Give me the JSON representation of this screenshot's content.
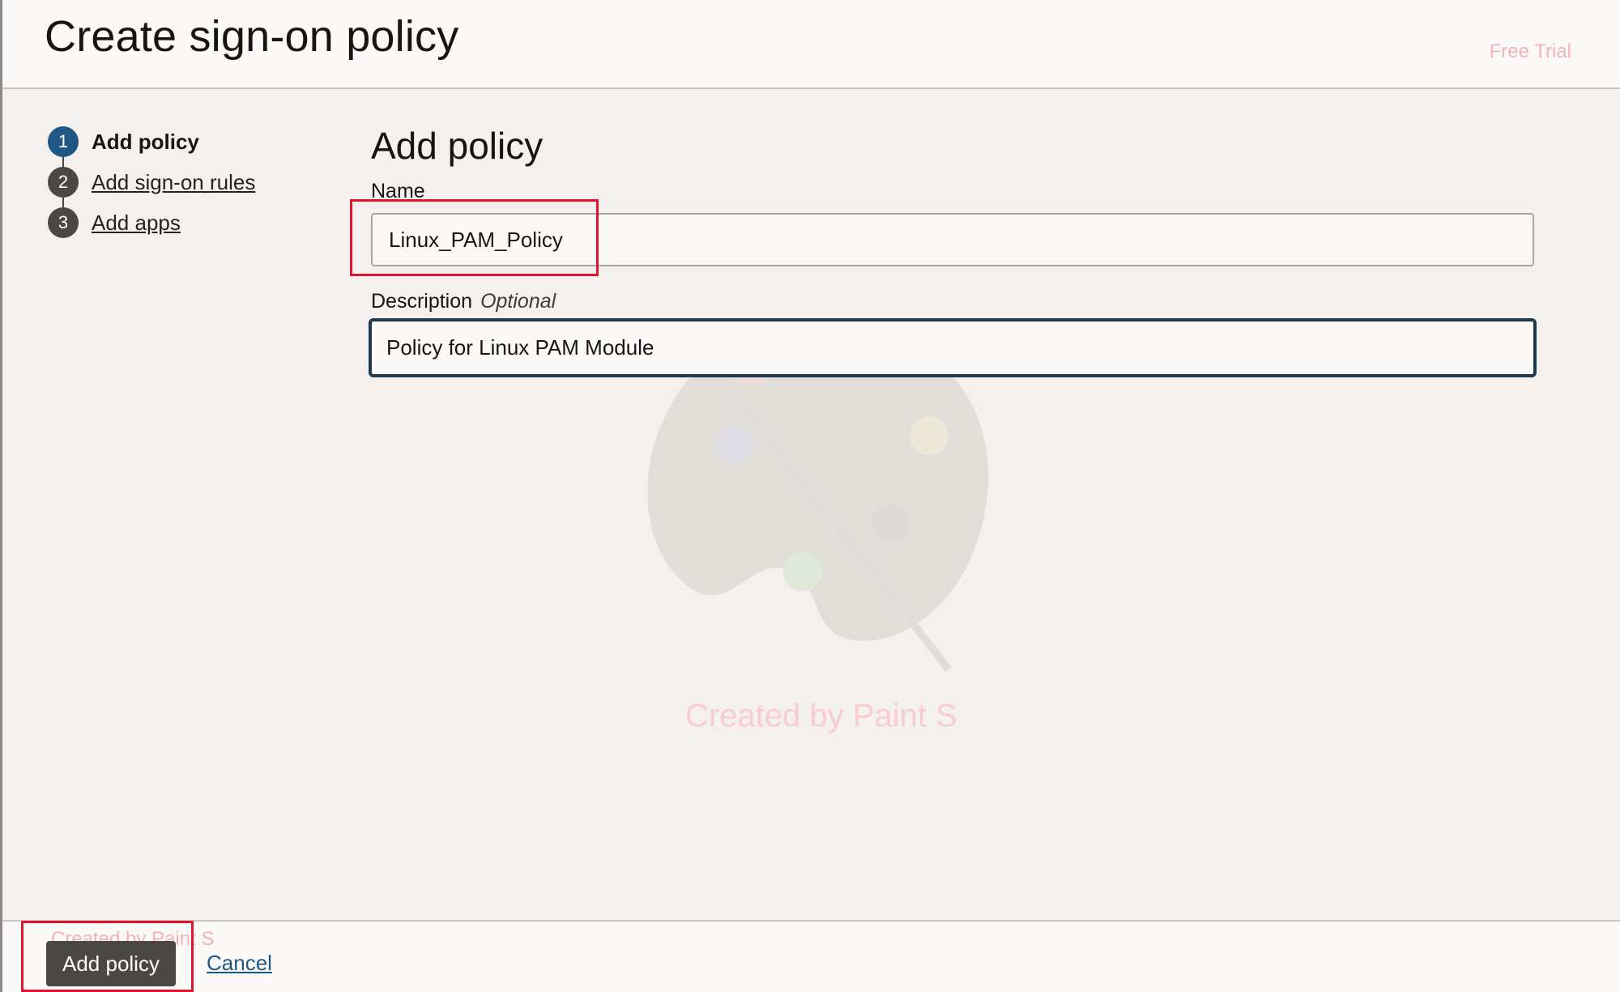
{
  "header": {
    "title": "Create sign-on policy",
    "watermark": "Free Trial"
  },
  "steps": [
    {
      "number": "1",
      "label": "Add policy",
      "active": true
    },
    {
      "number": "2",
      "label": "Add sign-on rules",
      "active": false
    },
    {
      "number": "3",
      "label": "Add apps",
      "active": false
    }
  ],
  "form": {
    "section_title": "Add policy",
    "name_label": "Name",
    "name_value": "Linux_PAM_Policy",
    "description_label": "Description",
    "description_optional": "Optional",
    "description_value": "Policy for Linux PAM Module"
  },
  "watermark_center": "Created by Paint S",
  "footer": {
    "primary_button": "Add policy",
    "cancel_link": "Cancel",
    "watermark": "Created by Paint S"
  },
  "colors": {
    "active_step": "#1e5784",
    "highlight": "#e0142f",
    "primary_button": "#4a4745"
  }
}
